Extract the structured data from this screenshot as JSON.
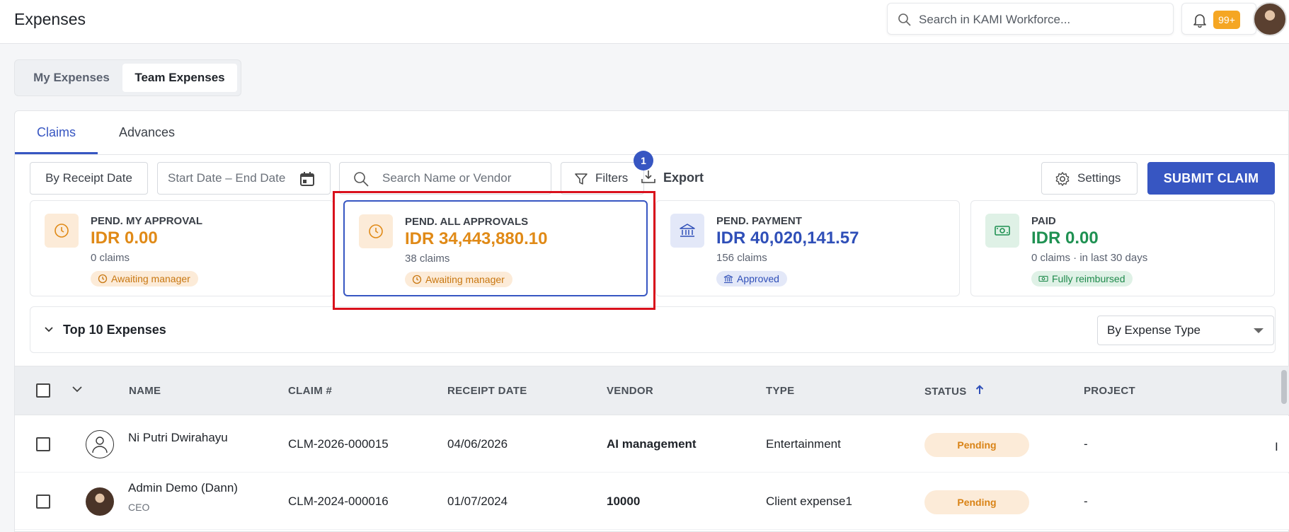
{
  "header": {
    "title": "Expenses",
    "search_placeholder": "Search in KAMI Workforce...",
    "notification_count": "99+"
  },
  "segment": {
    "my_label": "My Expenses",
    "team_label": "Team Expenses"
  },
  "tabs": [
    {
      "label": "Claims",
      "active": true
    },
    {
      "label": "Advances",
      "active": false
    }
  ],
  "toolbar": {
    "by_receipt_label": "By Receipt Date",
    "date_range_placeholder": "Start Date – End Date",
    "search_placeholder": "Search Name or Vendor",
    "filters_label": "Filters",
    "filters_count": "1",
    "export_label": "Export",
    "settings_label": "Settings",
    "submit_label": "SUBMIT CLAIM"
  },
  "cards": [
    {
      "label": "PEND. MY APPROVAL",
      "amount": "IDR 0.00",
      "sub": "0 claims",
      "chip": "Awaiting manager",
      "icon": "clock-icon",
      "accent": "#e08a17"
    },
    {
      "label": "PEND. ALL APPROVALS",
      "amount": "IDR 34,443,880.10",
      "sub": "38 claims",
      "chip": "Awaiting manager",
      "icon": "clock-icon",
      "accent": "#e08a17",
      "selected": true
    },
    {
      "label": "PEND. PAYMENT",
      "amount": "IDR 40,020,141.57",
      "sub": "156 claims",
      "chip": "Approved",
      "icon": "bank-icon",
      "accent": "#2f4fb8"
    },
    {
      "label": "PAID",
      "amount": "IDR 0.00",
      "sub": "0 claims · in last 30 days",
      "chip": "Fully reimbursed",
      "icon": "cash-icon",
      "accent": "#1f9152"
    }
  ],
  "top10": {
    "title": "Top 10 Expenses",
    "group_by": "By Expense Type"
  },
  "table": {
    "columns": [
      "NAME",
      "CLAIM #",
      "RECEIPT DATE",
      "VENDOR",
      "TYPE",
      "STATUS",
      "PROJECT"
    ],
    "sorted_column": "STATUS",
    "rows": [
      {
        "name": "Ni Putri Dwirahayu",
        "subtitle": "",
        "claim": "CLM-2026-000015",
        "date": "04/06/2026",
        "vendor": "AI management",
        "type": "Entertainment",
        "status": "Pending",
        "project": "-",
        "overflow": "I"
      },
      {
        "name": "Admin Demo (Dann)",
        "subtitle": "CEO",
        "claim": "CLM-2024-000016",
        "date": "01/07/2024",
        "vendor": "10000",
        "type": "Client expense1",
        "status": "Pending",
        "project": "-",
        "overflow": ""
      }
    ]
  }
}
